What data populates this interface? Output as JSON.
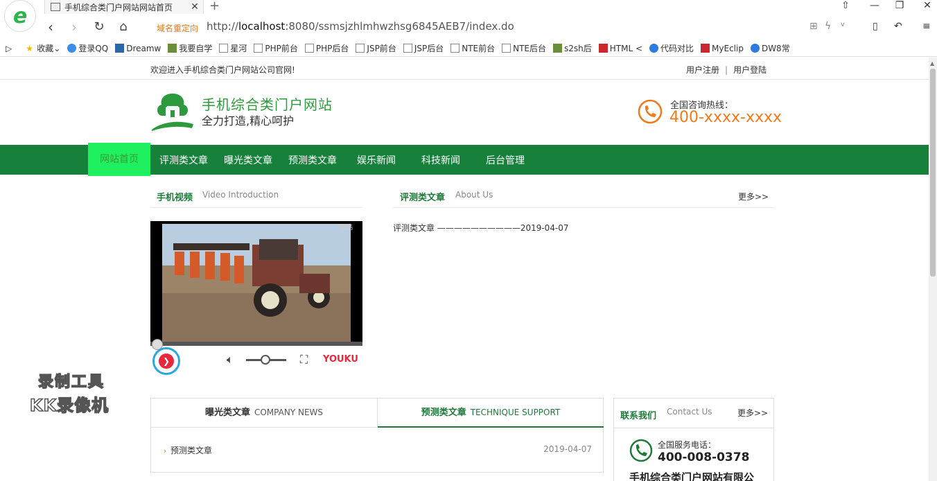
{
  "browser": {
    "tab_title": "手机综合类门户网站网站首页",
    "redirect_label": "域名重定向",
    "url_prefix": "http://",
    "url_host": "localhost",
    "url_rest": ":8080/ssmsjzhlmhwzhsg6845AEB7/index.do",
    "bookmarks": [
      "收藏",
      "登录QQ",
      "Dreamw",
      "我要自学",
      "星河",
      "PHP前台",
      "PHP后台",
      "JSP前台",
      "JSP后台",
      "NTE前台",
      "NTE后台",
      "s2sh后",
      "HTML <",
      "代码对比",
      "MyEclip",
      "DW8常"
    ]
  },
  "topline": {
    "welcome": "欢迎进入手机综合类门户网站公司官网!",
    "register": "用户注册",
    "login": "用户登陆",
    "separator": "|"
  },
  "header": {
    "site_title": "手机综合类门户网站",
    "slogan": "全力打造,精心呵护",
    "hotline_label": "全国咨询热线：",
    "hotline_number": "400-xxxx-xxxx"
  },
  "nav": [
    "网站首页",
    "评测类文章",
    "曝光类文章",
    "预测类文章",
    "娱乐新闻",
    "科技新闻",
    "后台管理"
  ],
  "video_section": {
    "title": "手机视频",
    "subtitle": "Video Introduction",
    "player_brand": "YOUKU",
    "watermark": "优酷"
  },
  "review_section": {
    "title": "评测类文章",
    "subtitle": "About Us",
    "more": "更多>>",
    "article": "评测类文章 ——————————2019-04-07"
  },
  "recorder_watermark": {
    "line1": "录制工具",
    "line2": "KK录像机"
  },
  "news_tabs": {
    "tab1_cn": "曝光类文章",
    "tab1_en": "COMPANY NEWS",
    "tab2_cn": "预测类文章",
    "tab2_en": "TECHNIQUE SUPPORT",
    "row_title": "预测类文章",
    "row_date": "2019-04-07"
  },
  "contact": {
    "title": "联系我们",
    "subtitle": "Contact Us",
    "more": "更多>>",
    "service_label": "全国服务电话：",
    "service_number": "400-008-0378",
    "company": "手机综合类门户网站有限公"
  },
  "colors": {
    "brand_green": "#17803a",
    "active_nav": "#1ff060",
    "hotline_orange": "#f07a1b"
  }
}
